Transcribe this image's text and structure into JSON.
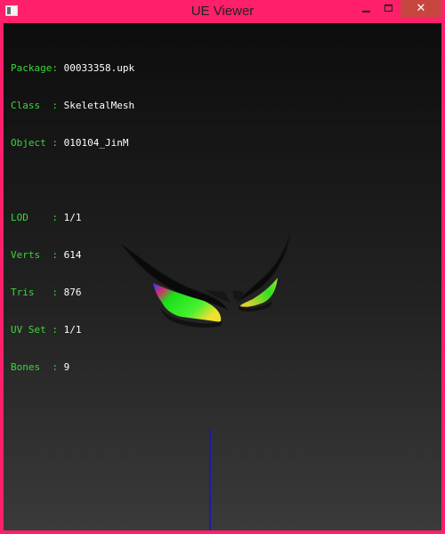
{
  "window": {
    "title": "UE Viewer",
    "title_bar_color": "#ff1f6b",
    "icons": {
      "app": "app-icon",
      "minimize": "minimize-icon",
      "maximize": "maximize-icon",
      "close": "close-icon"
    }
  },
  "info": {
    "package": {
      "label": "Package:",
      "value": "00033358.upk"
    },
    "class": {
      "label": "Class  :",
      "value": "SkeletalMesh"
    },
    "object": {
      "label": "Object :",
      "value": "010104_JinM"
    },
    "lod": {
      "label": "LOD    :",
      "value": "1/1"
    },
    "verts": {
      "label": "Verts  :",
      "value": "614"
    },
    "tris": {
      "label": "Tris   :",
      "value": "876"
    },
    "uvset": {
      "label": "UV Set :",
      "value": "1/1"
    },
    "bones": {
      "label": "Bones  :",
      "value": "9"
    }
  },
  "colors": {
    "label_text": "#3bd63b",
    "value_text": "#ffffff",
    "axis": "#1515d0"
  }
}
